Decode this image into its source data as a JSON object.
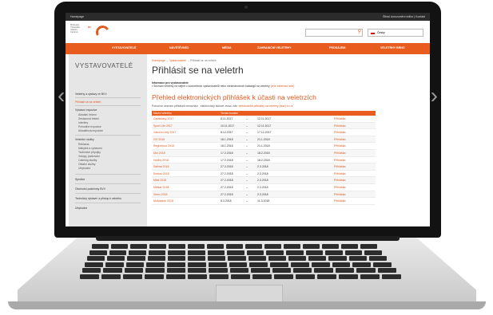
{
  "topbar": {
    "title": "Homepage",
    "links": "Šifrač dorozumění editor | Kontakt"
  },
  "header": {
    "logo_lines": [
      "Brněnské",
      "Výstaviště",
      "Veletrhy",
      "Centrum"
    ],
    "logo_mark": "BV",
    "search_placeholder": "",
    "language": "Česky"
  },
  "nav": {
    "items": [
      "VYSTAVOVATELÉ",
      "NÁVŠTĚVNÍCI",
      "MÉDIA",
      "ZAHRANIČNÍ VELETRHY",
      "PRONÁJEM",
      "VELETRHY BRNO"
    ]
  },
  "sidebar": {
    "heading": "VYSTAVOVATELÉ",
    "items": [
      {
        "label": "Veletrhy a výstavy ve BVV",
        "style": "normal"
      },
      {
        "label": "Přihlásit se na veletrh",
        "style": "active"
      },
      {
        "label": "Výstavní expozice",
        "style": "normal"
      },
      {
        "label": "Aktuální řešení",
        "style": "sub"
      },
      {
        "label": "Sestavová řešení",
        "style": "sub"
      },
      {
        "label": "Interiéry",
        "style": "sub"
      },
      {
        "label": "Pohodlné expozice",
        "style": "sub"
      },
      {
        "label": "Aktualitová expozice",
        "style": "sub"
      },
      {
        "label": "Veletržní služby",
        "style": "normal"
      },
      {
        "label": "Reklama",
        "style": "sub"
      },
      {
        "label": "Nábytek a vybavení",
        "style": "sub"
      },
      {
        "label": "Technické přípojky",
        "style": "sub"
      },
      {
        "label": "Vstupy, parkování",
        "style": "sub"
      },
      {
        "label": "Catering služby",
        "style": "sub"
      },
      {
        "label": "Ostatní služby",
        "style": "sub"
      },
      {
        "label": "Ubytování",
        "style": "sub"
      },
      {
        "label": "Spedice",
        "style": "normal"
      },
      {
        "label": "Obchodní podmínky BVV",
        "style": "normal"
      },
      {
        "label": "Technický výstavní a přístup k veletrhu",
        "style": "normal"
      },
      {
        "label": "Ubytování",
        "style": "normal"
      }
    ]
  },
  "main": {
    "breadcrumb": {
      "home": "Homepage",
      "sep": "→",
      "section": "Vystavovatelé",
      "current": "Přihlásit se na veletrh"
    },
    "title": "Přihlásit se na veletrh",
    "info_heading": "Informace pro vystavovatele",
    "info_text": "• Seznam veletrhy na stejně z konkrétních vystavovatelů nebo mezinárodních katalogů na veletrhy",
    "info_link": "(více informací zde)",
    "section_title": "Přehled elektronických přihlášek k účasti na veletrzích",
    "paragraph": "Pokud se seznam přihlášek nenachází , elektronický tiskové znovu zde:",
    "paragraph_link": "elektronické přihlášky na veletrhy (stav) k.n.a",
    "table": {
      "headers": [
        "Název veletrhu",
        "Termín konání",
        ""
      ],
      "rows": [
        {
          "name": "Candidacy 2017",
          "from": "8.11.2017",
          "dash": "–",
          "to": "12.11.2017",
          "action": "Přihláška"
        },
        {
          "name": "Sport Life 2017",
          "from": "10.11.2017",
          "dash": "–",
          "to": "12.11.2017",
          "action": "Přihláška"
        },
        {
          "name": "Vánoční trhy 2017",
          "from": "8.12.2017",
          "dash": "–",
          "to": "17.12.2017",
          "action": "Přihláška"
        },
        {
          "name": "GO 2018",
          "from": "18.1.2018",
          "dash": "–",
          "to": "21.1.2018",
          "action": "Přihláška"
        },
        {
          "name": "Regiontour 2018",
          "from": "18.1.2018",
          "dash": "–",
          "to": "21.1.2018",
          "action": "Přihláška"
        },
        {
          "name": "Dixi 2018",
          "from": "17.2.2018",
          "dash": "–",
          "to": "18.2.2018",
          "action": "Přihláška"
        },
        {
          "name": "Hobby 2018",
          "from": "17.2.2018",
          "dash": "–",
          "to": "18.2.2018",
          "action": "Přihláška"
        },
        {
          "name": "Salima 2018",
          "from": "27.2.2018",
          "dash": "–",
          "to": "2.3.2018",
          "action": "Přihláška"
        },
        {
          "name": "Embax 2018",
          "from": "27.2.2018",
          "dash": "–",
          "to": "2.3.2018",
          "action": "Přihláška"
        },
        {
          "name": "Mlék 2018",
          "from": "27.2.2018",
          "dash": "–",
          "to": "2.3.2018",
          "action": "Přihláška"
        },
        {
          "name": "Mlékař 2018",
          "from": "27.2.2018",
          "dash": "–",
          "to": "2.3.2018",
          "action": "Přihláška"
        },
        {
          "name": "Vinex 2018",
          "from": "27.2.2018",
          "dash": "–",
          "to": "2.3.2018",
          "action": "Přihláška"
        },
        {
          "name": "Motosalon 2018",
          "from": "8.3.2018",
          "dash": "–",
          "to": "11.3.2018",
          "action": "Přihláška"
        }
      ]
    }
  },
  "colors": {
    "accent": "#e85d1d",
    "frame": "#121212",
    "sidebar": "#e6e6e6"
  },
  "icons": [
    "search-icon",
    "flag-icon",
    "chevron-left-icon",
    "chevron-right-icon",
    "camera-icon"
  ]
}
